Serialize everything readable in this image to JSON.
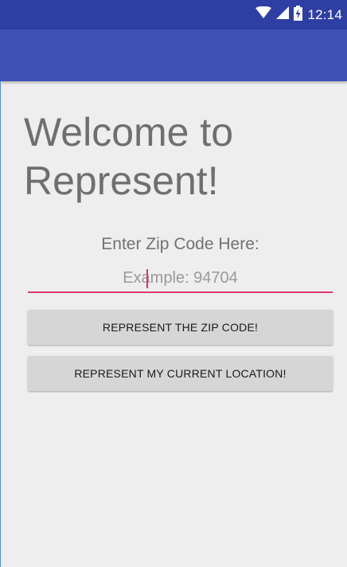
{
  "status_bar": {
    "time": "12:14",
    "icons": [
      "wifi-icon",
      "cell-signal-icon",
      "battery-charging-icon"
    ]
  },
  "colors": {
    "status_bar": "#2e3fa3",
    "app_bar": "#3f51b5",
    "accent": "#e0356e",
    "background": "#eeeeee",
    "button": "#d6d6d6"
  },
  "main": {
    "welcome_title": "Welcome to Represent!",
    "zip_label": "Enter Zip Code Here:",
    "zip_input": {
      "value": "",
      "placeholder": "Example: 94704"
    },
    "buttons": {
      "represent_zip": "REPRESENT THE ZIP CODE!",
      "represent_location": "REPRESENT MY CURRENT LOCATION!"
    }
  }
}
